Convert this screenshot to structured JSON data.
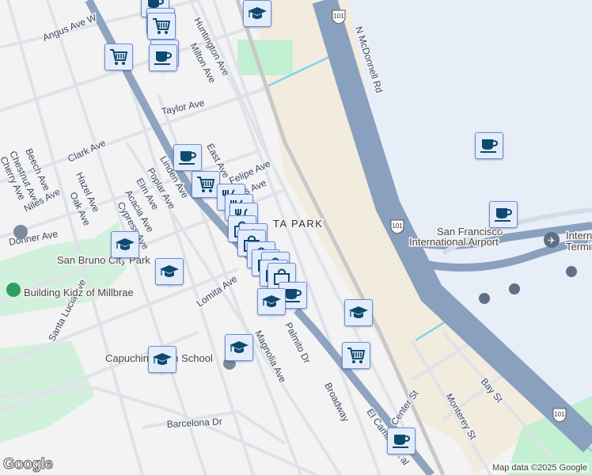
{
  "map": {
    "streets": [
      "Angus Ave W",
      "Huntington Ave",
      "Milton Ave",
      "Taylor Ave",
      "Clark Ave",
      "Beech Ave",
      "Chestnut Ave",
      "Cherry Ave",
      "Hazel Ave",
      "Niles Ave",
      "Oak Ave",
      "Linden Ave",
      "Poplar Ave",
      "Elm Ave",
      "Acacia Ave",
      "Cypress Ave",
      "East Ave",
      "Felipe Ave",
      "Donner Ave",
      "Lomita Ave",
      "Santa Lucia Ave",
      "Magnolia Ave",
      "Palmito Dr",
      "Broadway",
      "El Camino Real",
      "Center St",
      "Monterey St",
      "Bay St",
      "Barcelona Dr",
      "N McDonnell Rd",
      "Avis Ave"
    ],
    "highway_shield": "101",
    "neighborhood": "MILLBRAE HIGHLANDS / VILLA PARK",
    "neighborhood_visible": "TA PARK",
    "places": {
      "park": "San Bruno City Park",
      "school1": "Building Kidz of Millbrae",
      "school2": "Capuchino High School",
      "airport_line1": "San Francisco",
      "airport_line2": "International Airport",
      "terminal_line1": "Interna",
      "terminal_line2": "Termin"
    },
    "markers": [
      "grocery",
      "coffee",
      "school",
      "cafe",
      "restaurant",
      "shopping"
    ],
    "attribution": "Map data ©2025 Google",
    "logo": "Google",
    "colors": {
      "highway": "#8aa0bf",
      "marker_bg": "#e3ecfb",
      "marker_icon": "#0d4a6e",
      "park": "#c3efd2",
      "airport": "#e8eef8",
      "sand": "#f2ecdf",
      "water": "#7fd3ea"
    }
  }
}
